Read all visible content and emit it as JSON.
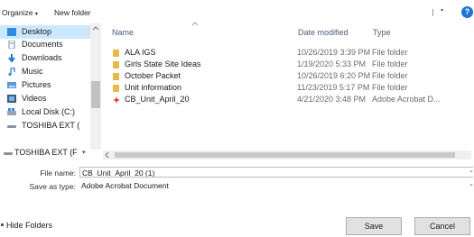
{
  "toolbar": {
    "organize_label": "Organize",
    "organize_caret": "▾",
    "new_folder_label": "New folder",
    "view_caret": "▾",
    "help_label": "?"
  },
  "nav": {
    "items": [
      {
        "label": "Desktop",
        "icon": "desktop-icon"
      },
      {
        "label": "Documents",
        "icon": "documents-icon"
      },
      {
        "label": "Downloads",
        "icon": "downloads-icon"
      },
      {
        "label": "Music",
        "icon": "music-icon"
      },
      {
        "label": "Pictures",
        "icon": "pictures-icon"
      },
      {
        "label": "Videos",
        "icon": "videos-icon"
      },
      {
        "label": "Local Disk (C:)",
        "icon": "local-disk-icon"
      },
      {
        "label": "TOSHIBA EXT (",
        "icon": "drive-icon"
      },
      {
        "label": "TOSHIBA EXT (F",
        "icon": "drive-icon"
      }
    ],
    "expand_caret": "▾"
  },
  "columns": {
    "name": "Name",
    "date_modified": "Date modified",
    "type": "Type"
  },
  "files": [
    {
      "name": "ALA IGS",
      "date": "10/26/2019 3:39 PM",
      "type": "File folder",
      "icon": "folder-icon"
    },
    {
      "name": "Girls State Site Ideas",
      "date": "1/19/2020 5:33 PM",
      "type": "File folder",
      "icon": "folder-icon"
    },
    {
      "name": "October Packet",
      "date": "10/26/2019 6:20 PM",
      "type": "File folder",
      "icon": "folder-icon"
    },
    {
      "name": "Unit information",
      "date": "11/23/2019 5:17 PM",
      "type": "File folder",
      "icon": "folder-icon"
    },
    {
      "name": "CB_Unit_April_20",
      "date": "4/21/2020 3:48 PM",
      "type": "Adobe Acrobat D...",
      "icon": "pdf-icon"
    }
  ],
  "form": {
    "file_name_label": "File name:",
    "file_name_value": "CB_Unit_April_20 (1)",
    "save_type_label": "Save as type:",
    "save_type_value": "Adobe Acrobat Document"
  },
  "footer": {
    "hide_folders_label": "Hide Folders",
    "save_label": "Save",
    "cancel_label": "Cancel"
  },
  "colors": {
    "selected_bg": "#cce8ff",
    "folder": "#e8b84a",
    "accent": "#1e74d4"
  }
}
